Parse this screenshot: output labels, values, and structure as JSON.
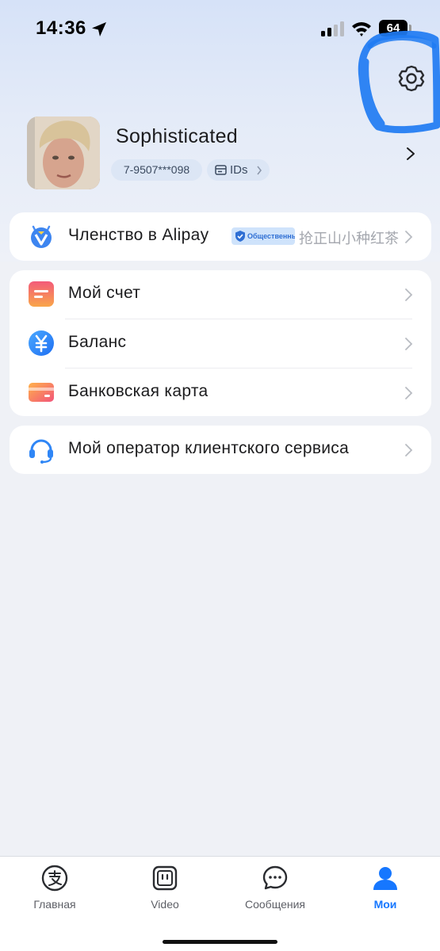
{
  "status_bar": {
    "time": "14:36",
    "battery": "64",
    "icons": [
      "location-arrow-icon",
      "signal-icon",
      "wifi-icon",
      "battery-icon"
    ]
  },
  "header": {
    "settings_icon": "gear-icon"
  },
  "profile": {
    "name": "Sophisticated",
    "phone": "7-9507***098",
    "ids_label": "IDs"
  },
  "membership": {
    "label": "Членство в Alipay",
    "badge": "Общественный",
    "hint": "抢正山小种红茶"
  },
  "accounts": {
    "items": [
      {
        "label": "Мой счет",
        "icon": "account-icon"
      },
      {
        "label": "Баланс",
        "icon": "yuan-coin-icon"
      },
      {
        "label": "Банковская карта",
        "icon": "bank-card-icon"
      }
    ]
  },
  "service": {
    "label": "Мой оператор клиентского сервиса",
    "icon": "headset-icon"
  },
  "tabbar": {
    "tabs": [
      {
        "label": "Главная",
        "icon": "alipay-home-icon",
        "active": false
      },
      {
        "label": "Video",
        "icon": "video-icon",
        "active": false
      },
      {
        "label": "Сообщения",
        "icon": "chat-icon",
        "active": false
      },
      {
        "label": "Мои",
        "icon": "person-icon",
        "active": true
      }
    ]
  },
  "colors": {
    "accent": "#1677ff",
    "annotation": "#1f7bf2",
    "page_bg": "#eff1f6"
  }
}
